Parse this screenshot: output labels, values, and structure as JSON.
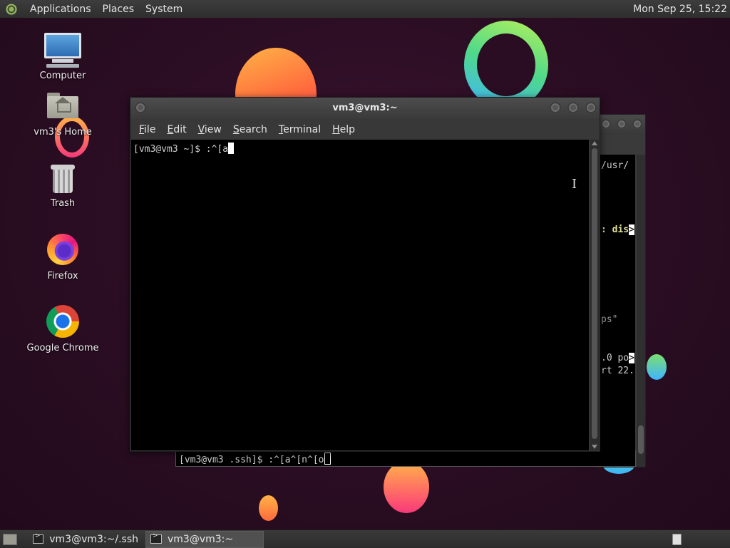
{
  "top_panel": {
    "menus": [
      "Applications",
      "Places",
      "System"
    ],
    "clock": "Mon Sep 25, 15:22"
  },
  "desktop_icons": [
    {
      "label": "Computer",
      "icon": "computer-icon"
    },
    {
      "label": "vm3's Home",
      "icon": "home-folder-icon"
    },
    {
      "label": "Trash",
      "icon": "trash-icon"
    },
    {
      "label": "Firefox",
      "icon": "firefox-icon"
    },
    {
      "label": "Google Chrome",
      "icon": "chrome-icon"
    }
  ],
  "terminal": {
    "title": "vm3@vm3:~",
    "menu": [
      "File",
      "Edit",
      "View",
      "Search",
      "Terminal",
      "Help"
    ],
    "menu_mnemonics": [
      "F",
      "E",
      "V",
      "S",
      "T",
      "H"
    ],
    "prompt": "[vm3@vm3 ~]$ :^[a"
  },
  "back_terminal": {
    "lines": [
      {
        "text": "/usr/",
        "style": "normal"
      },
      {
        "text": ": dis",
        "style": "bold",
        "overflow": ">"
      },
      {
        "text": "ps\"",
        "style": "dim"
      },
      {
        "text": ".0 po",
        "style": "normal",
        "overflow": ">"
      },
      {
        "text": "rt 22.",
        "style": "normal"
      }
    ],
    "prompt": "[vm3@vm3 .ssh]$ :^[a^[n^[o"
  },
  "taskbar": {
    "tasks": [
      {
        "label": "vm3@vm3:~/.ssh",
        "active": false
      },
      {
        "label": "vm3@vm3:~",
        "active": true
      }
    ]
  },
  "colors": {
    "desktop_bg": "#2a0d22",
    "panel_bg": "#333333",
    "terminal_bg": "#000000"
  }
}
